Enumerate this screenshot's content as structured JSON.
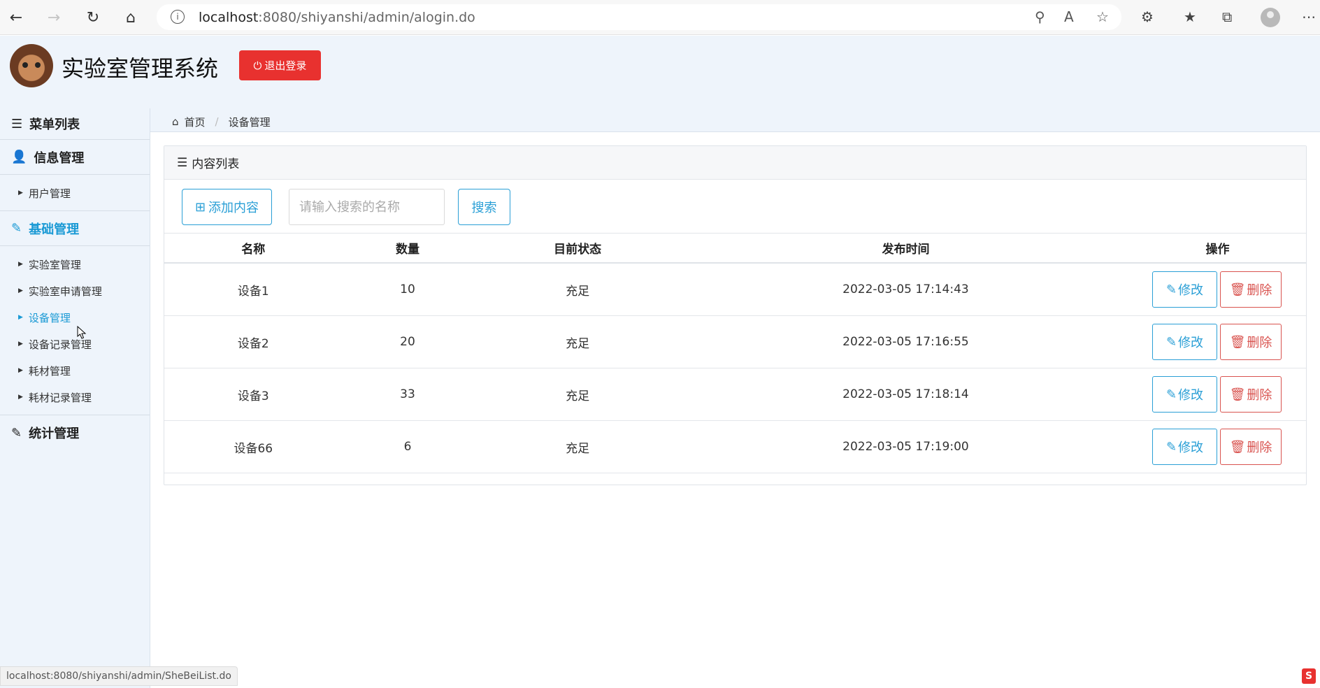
{
  "browser": {
    "url_host": "localhost",
    "url_path": ":8080/shiyanshi/admin/alogin.do",
    "status_url": "localhost:8080/shiyanshi/admin/SheBeiList.do"
  },
  "header": {
    "app_title": "实验室管理系统",
    "logout_label": "退出登录"
  },
  "sidebar": {
    "menu_title": "菜单列表",
    "groups": [
      {
        "label": "信息管理",
        "items": [
          "用户管理"
        ]
      },
      {
        "label": "基础管理",
        "items": [
          "实验室管理",
          "实验室申请管理",
          "设备管理",
          "设备记录管理",
          "耗材管理",
          "耗材记录管理"
        ]
      },
      {
        "label": "统计管理",
        "items": []
      }
    ]
  },
  "breadcrumb": {
    "home": "首页",
    "current": "设备管理"
  },
  "panel": {
    "title": "内容列表",
    "add_label": "添加内容",
    "search_placeholder": "请输入搜索的名称",
    "search_label": "搜索",
    "edit_label": "修改",
    "delete_label": "删除",
    "columns": [
      "名称",
      "数量",
      "目前状态",
      "发布时间",
      "操作"
    ],
    "rows": [
      {
        "name": "设备1",
        "count": "10",
        "status": "充足",
        "time": "2022-03-05 17:14:43"
      },
      {
        "name": "设备2",
        "count": "20",
        "status": "充足",
        "time": "2022-03-05 17:16:55"
      },
      {
        "name": "设备3",
        "count": "33",
        "status": "充足",
        "time": "2022-03-05 17:18:14"
      },
      {
        "name": "设备66",
        "count": "6",
        "status": "充足",
        "time": "2022-03-05 17:19:00"
      }
    ]
  },
  "colors": {
    "accent": "#2a9fd6",
    "danger": "#d9534f",
    "logout_bg": "#e8312f",
    "sidebar_bg": "#eef4fb"
  }
}
